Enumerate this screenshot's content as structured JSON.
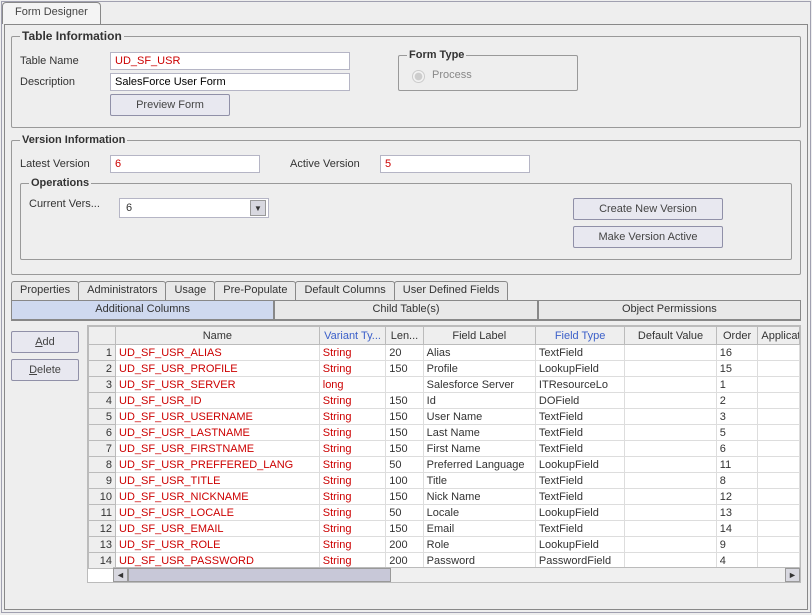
{
  "tab_title": "Form Designer",
  "table_info": {
    "legend": "Table Information",
    "table_name_label": "Table Name",
    "table_name_value": "UD_SF_USR",
    "description_label": "Description",
    "description_value": "SalesForce User Form",
    "preview_btn": "Preview Form",
    "form_type": {
      "legend": "Form Type",
      "option": "Process"
    }
  },
  "version_info": {
    "legend": "Version Information",
    "latest_label": "Latest Version",
    "latest_value": "6",
    "active_label": "Active Version",
    "active_value": "5",
    "operations": {
      "legend": "Operations",
      "current_label": "Current Vers...",
      "current_value": "6",
      "create_btn": "Create New Version",
      "make_active_btn": "Make Version Active"
    }
  },
  "tabs_row1": [
    "Properties",
    "Administrators",
    "Usage",
    "Pre-Populate",
    "Default Columns",
    "User Defined Fields"
  ],
  "tabs_row2": [
    "Additional Columns",
    "Child Table(s)",
    "Object Permissions"
  ],
  "tabs_row2_active": 0,
  "side_buttons": {
    "add": "Add",
    "delete": "Delete"
  },
  "columns": [
    {
      "label": "",
      "class": "col-w-rownum"
    },
    {
      "label": "Name",
      "class": "col-w-name"
    },
    {
      "label": "Variant Ty...",
      "class": "col-w-vt",
      "blue": true
    },
    {
      "label": "Len...",
      "class": "col-w-len"
    },
    {
      "label": "Field Label",
      "class": "col-w-fl"
    },
    {
      "label": "Field Type",
      "class": "col-w-ft",
      "blue": true
    },
    {
      "label": "Default Value",
      "class": "col-w-dv"
    },
    {
      "label": "Order",
      "class": "col-w-ord"
    },
    {
      "label": "Applicat",
      "class": "col-w-app"
    }
  ],
  "rows": [
    {
      "n": 1,
      "name": "UD_SF_USR_ALIAS",
      "vt": "String",
      "len": "20",
      "fl": "Alias",
      "ft": "TextField",
      "dv": "",
      "ord": "16"
    },
    {
      "n": 2,
      "name": "UD_SF_USR_PROFILE",
      "vt": "String",
      "len": "150",
      "fl": "Profile",
      "ft": "LookupField",
      "dv": "",
      "ord": "15"
    },
    {
      "n": 3,
      "name": "UD_SF_USR_SERVER",
      "vt": "long",
      "len": "",
      "fl": "Salesforce Server",
      "ft": "ITResourceLo",
      "dv": "",
      "ord": "1"
    },
    {
      "n": 4,
      "name": "UD_SF_USR_ID",
      "vt": "String",
      "len": "150",
      "fl": "Id",
      "ft": "DOField",
      "dv": "",
      "ord": "2"
    },
    {
      "n": 5,
      "name": "UD_SF_USR_USERNAME",
      "vt": "String",
      "len": "150",
      "fl": "User Name",
      "ft": "TextField",
      "dv": "",
      "ord": "3"
    },
    {
      "n": 6,
      "name": "UD_SF_USR_LASTNAME",
      "vt": "String",
      "len": "150",
      "fl": "Last Name",
      "ft": "TextField",
      "dv": "",
      "ord": "5"
    },
    {
      "n": 7,
      "name": "UD_SF_USR_FIRSTNAME",
      "vt": "String",
      "len": "150",
      "fl": "First Name",
      "ft": "TextField",
      "dv": "",
      "ord": "6"
    },
    {
      "n": 8,
      "name": "UD_SF_USR_PREFFERED_LANG",
      "vt": "String",
      "len": "50",
      "fl": "Preferred Language",
      "ft": "LookupField",
      "dv": "",
      "ord": "11"
    },
    {
      "n": 9,
      "name": "UD_SF_USR_TITLE",
      "vt": "String",
      "len": "100",
      "fl": "Title",
      "ft": "TextField",
      "dv": "",
      "ord": "8"
    },
    {
      "n": 10,
      "name": "UD_SF_USR_NICKNAME",
      "vt": "String",
      "len": "150",
      "fl": "Nick Name",
      "ft": "TextField",
      "dv": "",
      "ord": "12"
    },
    {
      "n": 11,
      "name": "UD_SF_USR_LOCALE",
      "vt": "String",
      "len": "50",
      "fl": "Locale",
      "ft": "LookupField",
      "dv": "",
      "ord": "13"
    },
    {
      "n": 12,
      "name": "UD_SF_USR_EMAIL",
      "vt": "String",
      "len": "150",
      "fl": "Email",
      "ft": "TextField",
      "dv": "",
      "ord": "14"
    },
    {
      "n": 13,
      "name": "UD_SF_USR_ROLE",
      "vt": "String",
      "len": "200",
      "fl": "Role",
      "ft": "LookupField",
      "dv": "",
      "ord": "9"
    },
    {
      "n": 14,
      "name": "UD_SF_USR_PASSWORD",
      "vt": "String",
      "len": "200",
      "fl": "Password",
      "ft": "PasswordField",
      "dv": "",
      "ord": "4"
    }
  ]
}
